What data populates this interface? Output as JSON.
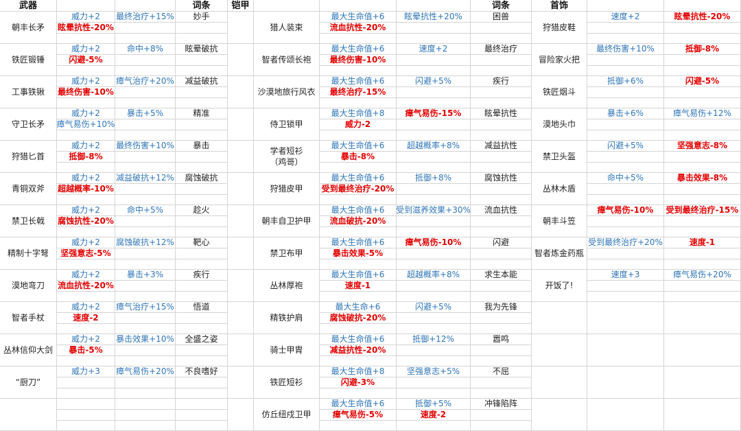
{
  "headers": [
    "武器",
    "词条",
    "铠甲",
    "词条",
    "首饰"
  ],
  "colors": {
    "positive": "#2e75b6",
    "negative": "#e30000",
    "grid": "#d4d4d4"
  },
  "weapons": [
    {
      "name": "朝丰长矛",
      "s1": "威力+2",
      "s2": "最终治疗+15%",
      "s3": "眩晕抗性-20%",
      "trait": "妙手"
    },
    {
      "name": "铁匠锻锤",
      "s1": "威力+2",
      "s2": "命中+8%",
      "s3": "闪避-5%",
      "trait": "眩晕破抗"
    },
    {
      "name": "工事铁锹",
      "s1": "威力+2",
      "s2": "瘴气治疗+20%",
      "s3": "最终伤害-10%",
      "trait": "减益破抗"
    },
    {
      "name": "守卫长矛",
      "s1": "威力+2",
      "s2": "暴击+5%",
      "s3": "瘴气易伤+10%",
      "trait": "精准"
    },
    {
      "name": "狩猎匕首",
      "s1": "威力+2",
      "s2": "最终伤害+10%",
      "s3": "抵御-8%",
      "trait": "暴击"
    },
    {
      "name": "青铜双斧",
      "s1": "威力+2",
      "s2": "减益破抗+12%",
      "s3": "超越概率-10%",
      "trait": "腐蚀破抗"
    },
    {
      "name": "禁卫长戟",
      "s1": "威力+2",
      "s2": "命中+5%",
      "s3": "腐蚀抗性-20%",
      "trait": "趁火"
    },
    {
      "name": "精制十字弩",
      "s1": "威力+2",
      "s2": "腐蚀破抗+12%",
      "s3": "坚强意志-5%",
      "trait": "靶心"
    },
    {
      "name": "漠地弯刀",
      "s1": "威力+2",
      "s2": "暴击+3%",
      "s3": "流血抗性-20%",
      "trait": "疾行"
    },
    {
      "name": "智者手杖",
      "s1": "威力+2",
      "s2": "瘴气治疗+15%",
      "s3": "速度-2",
      "trait": "悟道"
    },
    {
      "name": "丛林信仰大剑",
      "s1": "威力+2",
      "s2": "暴击效果+10%",
      "s3": "暴击-5%",
      "trait": "全盛之姿"
    },
    {
      "name": "“厨刀”",
      "s1": "威力+3",
      "s2": "瘴气易伤+20%",
      "s3": "",
      "trait": "不良嗜好"
    },
    {
      "name": "",
      "s1": "",
      "s2": "",
      "s3": "",
      "trait": ""
    }
  ],
  "armors": [
    {
      "name": "猎人装束",
      "s1": "最大生命值+6",
      "s2": "眩晕抗性+20%",
      "s3": "流血抗性-20%",
      "trait": "困兽"
    },
    {
      "name": "智者传颂长袍",
      "s1": "最大生命值+6",
      "s2": "速度+2",
      "s3": "最终伤害-10%",
      "trait": "最终治疗"
    },
    {
      "name": "沙漠地旅行风衣",
      "s1": "最大生命值+6",
      "s2": "闪避+5%",
      "s3": "最终治疗-15%",
      "trait": "疾行"
    },
    {
      "name": "侍卫锁甲",
      "s1": "最大生命值+8",
      "s2": "瘴气易伤-15%",
      "s3": "威力-2",
      "trait": "眩晕抗性"
    },
    {
      "name": "学者短衫\n（鸡哥）",
      "s1": "最大生命值+6",
      "s2": "超越概率+8%",
      "s3": "暴击-8%",
      "trait": "减益抗性"
    },
    {
      "name": "狩猎皮甲",
      "s1": "最大生命值+6",
      "s2": "抵御+8%",
      "s3": "受到最终治疗-20%",
      "trait": "腐蚀抗性"
    },
    {
      "name": "朝丰自卫护甲",
      "s1": "最大生命值+6",
      "s2": "受到滋养效果+30%",
      "s3": "流血破抗-20%",
      "trait": "流血抗性"
    },
    {
      "name": "禁卫布甲",
      "s1": "最大生命值+6",
      "s2": "瘴气易伤-10%",
      "s3": "暴击效果-5%",
      "trait": "闪避"
    },
    {
      "name": "丛林厚袍",
      "s1": "最大生命值+6",
      "s2": "超越概率+8%",
      "s3": "速度-1",
      "trait": "求生本能"
    },
    {
      "name": "精铁护肩",
      "s1": "最大生命+6",
      "s2": "闪避+5%",
      "s3": "腐蚀破抗-20%",
      "trait": "我为先锋"
    },
    {
      "name": "骑士甲胄",
      "s1": "最大生命值+6",
      "s2": "抵御+12%",
      "s3": "减益抗性-20%",
      "trait": "嚣鸣"
    },
    {
      "name": "铁匠短衫",
      "s1": "最大生命值+8",
      "s2": "坚强意志+5%",
      "s3": "闪避-3%",
      "trait": "不屈"
    },
    {
      "name": "仿丘纽戍卫甲",
      "s1": "最大生命值+6",
      "s2": "抵御+5%",
      "s3": "瘴气易伤-5%",
      "s4": "速度-2",
      "trait": "冲锋陷阵"
    }
  ],
  "accessories": [
    {
      "name": "狩猎皮鞋",
      "s1": "速度+2",
      "s2": "眩晕抗性-20%"
    },
    {
      "name": "冒险家火把",
      "s1": "最终伤害+10%",
      "s2": "抵御-8%"
    },
    {
      "name": "铁匠烟斗",
      "s1": "抵御+6%",
      "s2": "闪避-5%"
    },
    {
      "name": "漠地头巾",
      "s1": "暴击+6%",
      "s2": "瘴气易伤+12%"
    },
    {
      "name": "禁卫头盔",
      "s1": "闪避+5%",
      "s2": "坚强意志-8%"
    },
    {
      "name": "丛林木盾",
      "s1": "命中+5%",
      "s2": "暴击效果-8%"
    },
    {
      "name": "朝丰斗笠",
      "s1": "瘴气易伤-10%",
      "s2": "受到最终治疗-15%"
    },
    {
      "name": "智者炼金药瓶",
      "s1": "受到最终治疗+20%",
      "s2": "速度-1"
    },
    {
      "name": "开饭了!",
      "s1": "速度+3",
      "s2": "瘴气易伤+20%"
    }
  ]
}
